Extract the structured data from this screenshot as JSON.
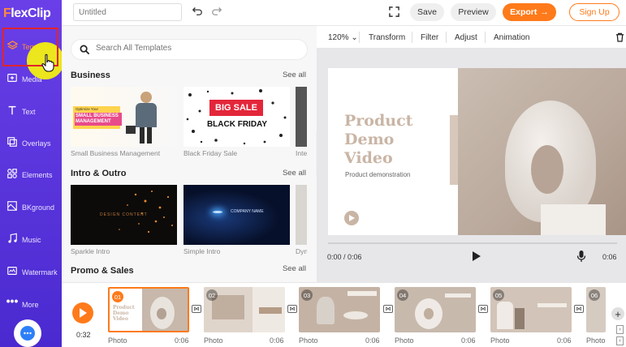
{
  "app": {
    "logo_prefix": "F",
    "logo_rest": "lexClip"
  },
  "sidebar": {
    "items": [
      {
        "label": "Templates",
        "icon": "layers-icon"
      },
      {
        "label": "Media",
        "icon": "media-icon"
      },
      {
        "label": "Text",
        "icon": "text-icon"
      },
      {
        "label": "Overlays",
        "icon": "overlays-icon"
      },
      {
        "label": "Elements",
        "icon": "elements-icon"
      },
      {
        "label": "BKground",
        "icon": "background-icon"
      },
      {
        "label": "Music",
        "icon": "music-icon"
      },
      {
        "label": "Watermark",
        "icon": "watermark-icon"
      },
      {
        "label": "More",
        "icon": "more-icon"
      }
    ]
  },
  "topbar": {
    "title_placeholder": "Untitled",
    "save_label": "Save",
    "preview_label": "Preview",
    "export_label": "Export",
    "signup_label": "Sign Up"
  },
  "panel": {
    "search_placeholder": "Search All Templates",
    "sections": [
      {
        "title": "Business",
        "see_all": "See all",
        "templates": [
          "Small Business Management",
          "Black Friday Sale",
          "Inte"
        ]
      },
      {
        "title": "Intro & Outro",
        "see_all": "See all",
        "templates": [
          "Sparkle Intro",
          "Simple Intro",
          "Dyn"
        ]
      },
      {
        "title": "Promo & Sales",
        "see_all": "See all"
      }
    ],
    "thumb_text": {
      "smb_tag": "Optimize Your",
      "smb_title": "SMALL BUSINESS MANAGEMENT",
      "bf_big": "BIG SALE",
      "bf_sub": "BLACK FRIDAY",
      "sparkle_text": "DESIGN CONTENT",
      "simple_text": "COMPANY NAME"
    }
  },
  "editor": {
    "zoom": "120%",
    "tools": [
      "Transform",
      "Filter",
      "Adjust",
      "Animation"
    ],
    "preview_title": [
      "Product",
      "Demo",
      "Video"
    ],
    "preview_subtitle": "Product demonstration",
    "time_current": "0:00 / 0:06",
    "time_total": "0:06"
  },
  "timeline": {
    "total_duration": "0:32",
    "clips": [
      {
        "num": "01",
        "label": "Photo",
        "duration": "0:06"
      },
      {
        "num": "02",
        "label": "Photo",
        "duration": "0:06"
      },
      {
        "num": "03",
        "label": "Photo",
        "duration": "0:06"
      },
      {
        "num": "04",
        "label": "Photo",
        "duration": "0:06"
      },
      {
        "num": "05",
        "label": "Photo",
        "duration": "0:06"
      },
      {
        "num": "06",
        "label": "Photo",
        "duration": ""
      }
    ]
  },
  "colors": {
    "accent": "#ff7a1a",
    "sidebar": "#5a34e0",
    "highlight": "#e0252b"
  }
}
